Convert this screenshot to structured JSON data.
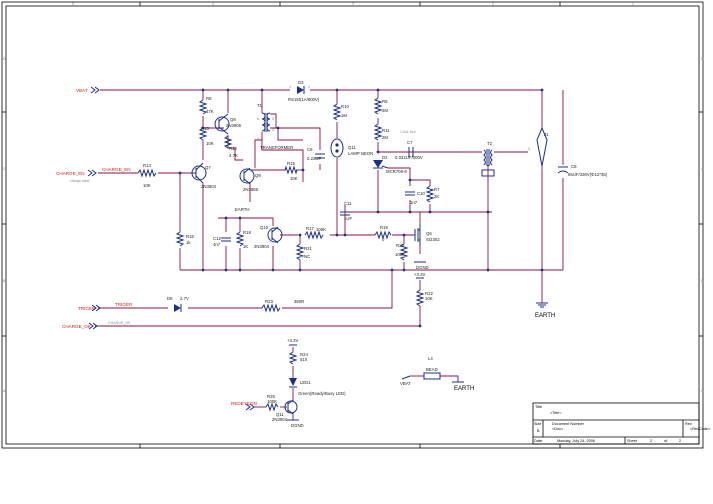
{
  "nets": {
    "vbat": "VBAT",
    "charge_en": "CHARGE_EN",
    "charge_en_label": "CHARGE_EN",
    "charge_start": "charge start",
    "trigger": "TRIGER",
    "trigger_label": "TRIGER",
    "charge_ok": "CHARGE_OK",
    "charge_ok_label": "CHARGE_OK",
    "redeye": "REDEYEON",
    "v33": "+3.3V",
    "v33b": "+3.3V",
    "earth": "EARTH",
    "earth2": "EARTH",
    "dgnd": "DGND",
    "dgnd2": "DGND",
    "vbat2": "VBAT"
  },
  "components": {
    "r8": {
      "ref": "R8",
      "value": "47K"
    },
    "r13": {
      "ref": "R13",
      "value": "10K"
    },
    "r12": {
      "ref": "R12",
      "value": "4.7K"
    },
    "q8": {
      "ref": "Q8",
      "value": "2N3906"
    },
    "q7": {
      "ref": "Q7",
      "value": "2N3904"
    },
    "q9": {
      "ref": "Q9",
      "value": "2N3865"
    },
    "q10": {
      "ref": "Q10",
      "value": "2N3904"
    },
    "q11": {
      "ref": "Q11",
      "value": "2N3904"
    },
    "r14": {
      "ref": "R14",
      "value": "10K"
    },
    "r15": {
      "ref": "R15",
      "value": "10K"
    },
    "r18": {
      "ref": "R18",
      "value": "1K"
    },
    "c12": {
      "ref": "C12",
      "value": "4n7"
    },
    "t1": {
      "ref": "T1",
      "value": "TRANSFORMER"
    },
    "d3": {
      "ref": "D3",
      "value": "RS1M(1A/800V)"
    },
    "c6": {
      "ref": "C6",
      "value": "0.22UF"
    },
    "r16": {
      "ref": "R16",
      "value": "1k"
    },
    "r10": {
      "ref": "R10",
      "value": "1M"
    },
    "q11d": {
      "ref": "Q11",
      "value": "LAMP NEON"
    },
    "r9": {
      "ref": "R9",
      "value": "2M"
    },
    "r11": {
      "ref": "R11",
      "value": "2M"
    },
    "d2": {
      "ref": "D2",
      "value": "MCR706-8"
    },
    "c7": {
      "ref": "C7",
      "value": "0.022UF/400V"
    },
    "c10": {
      "ref": "C10",
      "value": "1n7"
    },
    "r7": {
      "ref": "R7",
      "value": "2K"
    },
    "c11": {
      "ref": "C11",
      "value": "1UF"
    },
    "r17": {
      "ref": "R17",
      "value": "100K"
    },
    "r21": {
      "ref": "R21",
      "value": "NC"
    },
    "r19": {
      "ref": "R19",
      "value": "0"
    },
    "r20": {
      "ref": "R20",
      "value": "100K"
    },
    "q6": {
      "ref": "Q6",
      "value": "SI2302"
    },
    "t2": {
      "ref": "T2",
      "value": ""
    },
    "j1": {
      "ref": "J1",
      "value": ""
    },
    "c8": {
      "ref": "C8",
      "value": "85UF/330V(Φ12*35)"
    },
    "r22": {
      "ref": "R22",
      "value": "10K"
    },
    "d5": {
      "ref": "D5",
      "value": "2.7V"
    },
    "r23": {
      "ref": "R23",
      "value": "360R"
    },
    "r24": {
      "ref": "R24",
      "value": "510"
    },
    "led1": {
      "ref": "LED1",
      "value": "Green(Ready/Busy LED)"
    },
    "r25": {
      "ref": "R25",
      "value": "100K"
    },
    "l4": {
      "ref": "L4",
      "value": "BEAD"
    }
  },
  "annotation": "1.5x1.5x4",
  "border": {
    "cols": [
      "1",
      "2",
      "3",
      "4",
      "5"
    ],
    "rows": [
      "A",
      "B",
      "C",
      "D"
    ]
  },
  "title_block": {
    "title_label": "Title",
    "title_value": "<Title>",
    "size_label": "Size",
    "size_value": "B",
    "docnum_label": "Document Number",
    "docnum_value": "<Doc>",
    "rev_label": "Rev",
    "rev_value": "<RevCode>",
    "date_label": "Date:",
    "date_value": "Monday, July 24, 2006",
    "sheet_label": "Sheet",
    "sheet_value": "2",
    "of_label": "of",
    "of_value": "2"
  }
}
